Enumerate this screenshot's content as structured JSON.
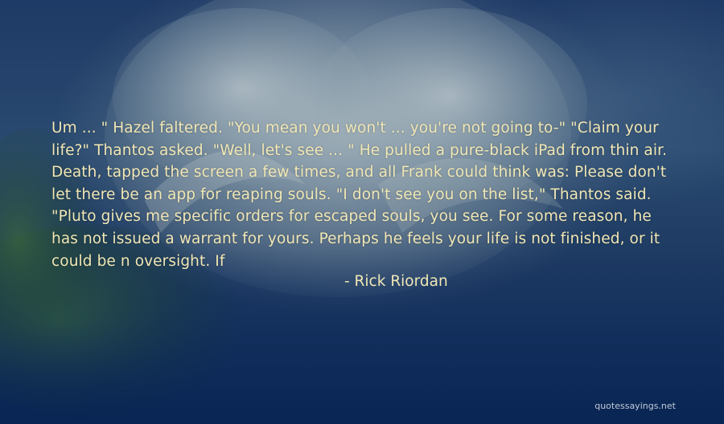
{
  "quote": {
    "text": "Um ... \" Hazel faltered. \"You mean you won't ... you're not going to-\" \"Claim your life?\" Thantos asked. \"Well, let's see ... \" He pulled a pure-black iPad from thin air. Death, tapped the screen a few times, and all Frank could think was: Please don't let there be an app for reaping souls. \"I don't see you on the list,\" Thantos said. \"Pluto gives me specific orders for escaped souls, you see. For some reason, he has not issued a warrant for yours. Perhaps he feels your life is not finished, or it could be n oversight. If",
    "author": "- Rick Riordan"
  },
  "watermark": "quotessayings.net",
  "colors": {
    "text": "#f0e7b5",
    "background_top": "#1e3a66",
    "background_bottom": "#0b2650",
    "rose_highlight": "#c8d2d4",
    "leaf_green": "#2e5a2a"
  }
}
